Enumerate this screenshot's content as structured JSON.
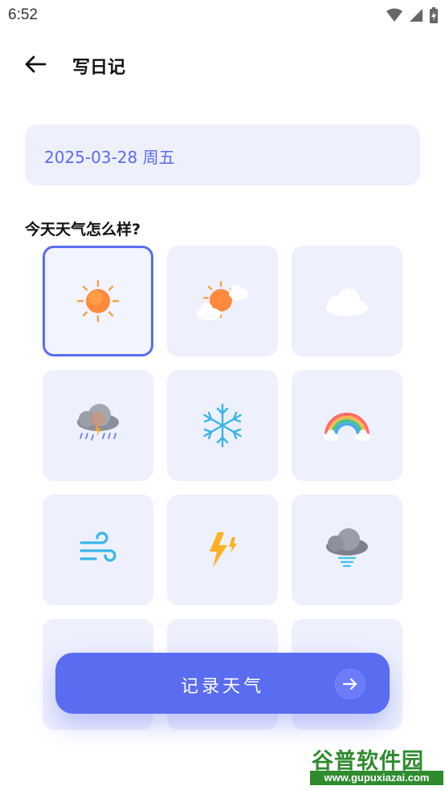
{
  "status_bar": {
    "time": "6:52",
    "icons": [
      "wifi-icon",
      "cell-signal-icon",
      "battery-charging-icon"
    ]
  },
  "header": {
    "title": "写日记",
    "back_icon": "arrow-left-icon"
  },
  "date_field": {
    "value": "2025-03-28 周五"
  },
  "weather_section": {
    "question": "今天天气怎么样?",
    "selected_index": 0,
    "options": [
      {
        "icon": "sun-icon"
      },
      {
        "icon": "partly-cloudy-icon"
      },
      {
        "icon": "cloud-icon"
      },
      {
        "icon": "thunderstorm-rain-icon"
      },
      {
        "icon": "snowflake-icon"
      },
      {
        "icon": "rainbow-icon"
      },
      {
        "icon": "wind-icon"
      },
      {
        "icon": "lightning-icon"
      },
      {
        "icon": "tornado-icon"
      },
      {
        "icon": "weather-option-10"
      },
      {
        "icon": "weather-option-11"
      },
      {
        "icon": "weather-option-12"
      }
    ]
  },
  "cta": {
    "label": "记录天气",
    "icon": "arrow-right-icon"
  },
  "watermark": {
    "title": "谷普软件园",
    "url": "www.gupuxiazai.com"
  },
  "colors": {
    "accent": "#5a6cf0",
    "tile_bg": "#eef0fd"
  }
}
